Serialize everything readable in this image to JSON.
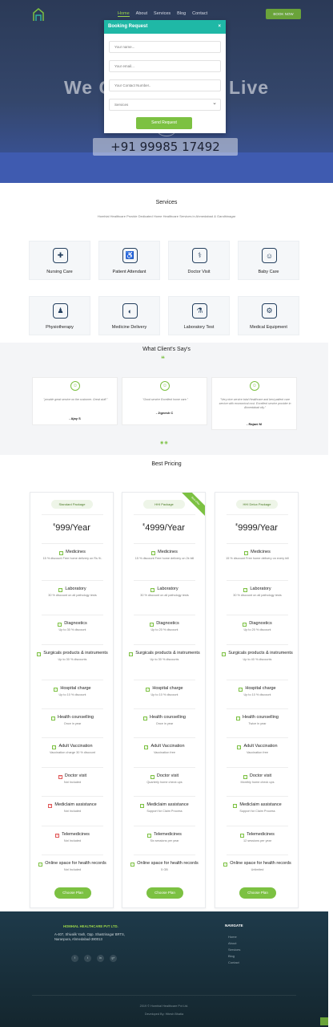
{
  "nav": {
    "items": [
      "Home",
      "About",
      "Services",
      "Blog",
      "Contact"
    ],
    "book_label": "BOOK NOW"
  },
  "hero": {
    "title_left": "We C",
    "title_right": "Live",
    "phone": "+91 99985 17492"
  },
  "modal": {
    "title": "Booking Request",
    "close": "×",
    "name_placeholder": "Your name...",
    "email_placeholder": "Your email...",
    "contact_placeholder": "Your Contact Number..",
    "services_select": "Services",
    "send_label": "Send Request"
  },
  "services": {
    "title": "Services",
    "subtitle": "Homhial Healthcare Provide Dedicated Home Healthcare Services in Ahmedabad & Gandhinagar",
    "items": [
      {
        "label": "Nursing Care",
        "icon": "nurse-icon"
      },
      {
        "label": "Patient Attendant",
        "icon": "attendant-icon"
      },
      {
        "label": "Doctor Visit",
        "icon": "doctor-icon"
      },
      {
        "label": "Baby Care",
        "icon": "baby-icon"
      },
      {
        "label": "Physiotherapy",
        "icon": "physio-icon"
      },
      {
        "label": "Medicine Delivery",
        "icon": "medicine-icon"
      },
      {
        "label": "Laboratory Test",
        "icon": "microscope-icon"
      },
      {
        "label": "Medical Equipment",
        "icon": "equipment-icon"
      }
    ]
  },
  "testimonials": {
    "title": "What Client's Say's",
    "items": [
      {
        "quote": "\"provide great service on the customer. Great stuff.\"",
        "name": "- Ajay S"
      },
      {
        "quote": "\"Good service Excellent home care.\"",
        "name": "- Jignesh C"
      },
      {
        "quote": "\"Very nice service total Healthcare and best patient care service with economical cost. Excellent service provider in Ahmedabad city.\"",
        "name": "- Rajani M"
      }
    ]
  },
  "pricing": {
    "title": "Best Pricing",
    "ribbon": "Best Offer",
    "choose_label": "Choose Plan",
    "plans": [
      {
        "name": "Standard Package",
        "currency": "₹",
        "price": "999/Year",
        "features": [
          {
            "t": "Medicines",
            "d": "15 % discount Free home delivery on Rs 9/-",
            "ok": true
          },
          {
            "t": "Laboratory",
            "d": "30 % discount on all pathology tests",
            "ok": true
          },
          {
            "t": "Diagnostics",
            "d": "Up to 30 % discount",
            "ok": true
          },
          {
            "t": "Surgicals products & instruments",
            "d": "Up to 30 % discounts",
            "ok": true
          },
          {
            "t": "Hospital charge",
            "d": "Up to 10 % discount",
            "ok": true
          },
          {
            "t": "Health counselling",
            "d": "Once in year",
            "ok": true
          },
          {
            "t": "Adult Vaccination",
            "d": "Vaccination charge 30 % discount",
            "ok": true
          },
          {
            "t": "Doctor visit",
            "d": "Not Included",
            "ok": false
          },
          {
            "t": "Mediclaim assistance",
            "d": "Not Included",
            "ok": false
          },
          {
            "t": "Telemedicines",
            "d": "Not Included",
            "ok": false
          },
          {
            "t": "Online space for health records",
            "d": "Not Included",
            "ok": true
          }
        ]
      },
      {
        "name": "HHI Package",
        "currency": "₹",
        "price": "4999/Year",
        "features": [
          {
            "t": "Medicines",
            "d": "15 % discount Free home delivery on 2k bill",
            "ok": true
          },
          {
            "t": "Laboratory",
            "d": "30 % discount on all pathology tests",
            "ok": true
          },
          {
            "t": "Diagnostics",
            "d": "Up to 20 % discount",
            "ok": true
          },
          {
            "t": "Surgicals products & instruments",
            "d": "Up to 30 % discounts",
            "ok": true
          },
          {
            "t": "Hospital charge",
            "d": "Up to 10 % discount",
            "ok": true
          },
          {
            "t": "Health counselling",
            "d": "Once in year",
            "ok": true
          },
          {
            "t": "Adult Vaccination",
            "d": "Vaccination free",
            "ok": true
          },
          {
            "t": "Doctor visit",
            "d": "Quarterly home check ups",
            "ok": true
          },
          {
            "t": "Mediclaim assistance",
            "d": "Support for Claim Process",
            "ok": true
          },
          {
            "t": "Telemedicines",
            "d": "Six sessions per year",
            "ok": true
          },
          {
            "t": "Online space for health records",
            "d": "5 GB",
            "ok": true
          }
        ]
      },
      {
        "name": "HHI Delux Package",
        "currency": "₹",
        "price": "9999/Year",
        "features": [
          {
            "t": "Medicines",
            "d": "15 % discount Free home delivery on every bill",
            "ok": true
          },
          {
            "t": "Laboratory",
            "d": "30 % discount on all pathology tests",
            "ok": true
          },
          {
            "t": "Diagnostics",
            "d": "Up to 20 % discount",
            "ok": true
          },
          {
            "t": "Surgicals products & instruments",
            "d": "Up to 40 % discounts",
            "ok": true
          },
          {
            "t": "Hospital charge",
            "d": "Up to 10 % discount",
            "ok": true
          },
          {
            "t": "Health counselling",
            "d": "Twice in year",
            "ok": true
          },
          {
            "t": "Adult Vaccination",
            "d": "Vaccination free",
            "ok": true
          },
          {
            "t": "Doctor visit",
            "d": "Monthly home check ups",
            "ok": true
          },
          {
            "t": "Mediclaim assistance",
            "d": "Support for Claim Process",
            "ok": true
          },
          {
            "t": "Telemedicines",
            "d": "12 sessions per year",
            "ok": true
          },
          {
            "t": "Online space for health records",
            "d": "Unlimited",
            "ok": true
          }
        ]
      }
    ]
  },
  "footer": {
    "brand": "HOMHIAL HEALTHCARE PVT LTD.",
    "address": [
      "A-407, Shivalik Yash, Opp. Shastrinagar BRTS,",
      "Naranpura, Ahmedabad-380013"
    ],
    "social": [
      "f",
      "t",
      "in",
      "g+"
    ],
    "nav_title": "NAVIGATE",
    "nav_items": [
      "Home",
      "About",
      "Services",
      "Blog",
      "Contact"
    ],
    "copyright": "2019 © Homhial Healthcare Pvt Ltd.",
    "developed": "Developed By: Hitesh Bhatia"
  }
}
